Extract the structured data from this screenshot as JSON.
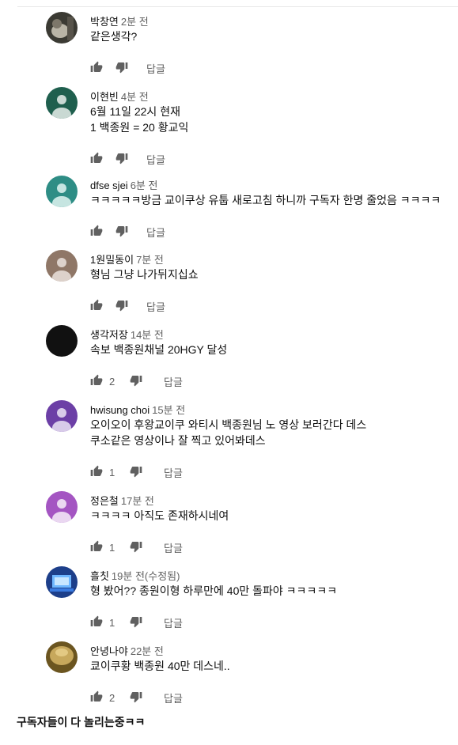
{
  "comments": [
    {
      "author": "박창연",
      "time": "2분 전",
      "lines": [
        "같은생각?"
      ],
      "likes": "",
      "reply_label": "답글",
      "avatar": {
        "kind": "photo-cat",
        "colors": [
          "#3b3a33",
          "#b9b4a6"
        ]
      }
    },
    {
      "author": "이현빈",
      "time": "4분 전",
      "lines": [
        "6월 11일 22시 현재",
        "1 백종원 = 20 황교익"
      ],
      "likes": "",
      "reply_label": "답글",
      "avatar": {
        "kind": "default",
        "colors": [
          "#1f5f4e",
          "#c9d9d3"
        ]
      }
    },
    {
      "author": "dfse sjei",
      "time": "6분 전",
      "lines": [
        "ㅋㅋㅋㅋㅋ방금 교이쿠상 유툽 새로고침 하니까 구독자 한명 줄었음 ㅋㅋㅋㅋ"
      ],
      "likes": "",
      "reply_label": "답글",
      "avatar": {
        "kind": "default",
        "colors": [
          "#2e8d85",
          "#c6e5e1"
        ]
      }
    },
    {
      "author": "1원밀동이",
      "time": "7분 전",
      "lines": [
        "형님 그냥 나가뒤지십쇼"
      ],
      "likes": "",
      "reply_label": "답글",
      "avatar": {
        "kind": "default",
        "colors": [
          "#8f7767",
          "#ddd2cb"
        ]
      }
    },
    {
      "author": "생각저장",
      "time": "14분 전",
      "lines": [
        "속보 백종원채널 20HGY 달성"
      ],
      "likes": "2",
      "reply_label": "답글",
      "avatar": {
        "kind": "solid",
        "colors": [
          "#111111",
          "#111111"
        ]
      }
    },
    {
      "author": "hwisung choi",
      "time": "15분 전",
      "lines": [
        "오이오이 후왕교이쿠 와티시 백종원님 노 영상 보러간다 데스",
        "쿠소같은 영상이나 잘 찍고 있어봐데스"
      ],
      "likes": "1",
      "reply_label": "답글",
      "avatar": {
        "kind": "default",
        "colors": [
          "#6c3fa6",
          "#d8cbe9"
        ]
      }
    },
    {
      "author": "정은철",
      "time": "17분 전",
      "lines": [
        "ㅋㅋㅋㅋ  아직도 존재하시네여"
      ],
      "likes": "1",
      "reply_label": "답글",
      "avatar": {
        "kind": "default",
        "colors": [
          "#a455c2",
          "#ead7f1"
        ]
      }
    },
    {
      "author": "흘칫",
      "time": "19분 전(수정됨)",
      "lines": [
        "형 봤어?? 종원이형 하루만에 40만 돌파야 ㅋㅋㅋㅋㅋ"
      ],
      "likes": "1",
      "reply_label": "답글",
      "avatar": {
        "kind": "photo-blue",
        "colors": [
          "#1d3f8a",
          "#6fb7ff"
        ]
      }
    },
    {
      "author": "안녕나야",
      "time": "22분 전",
      "lines": [
        "쿄이쿠황 백종원 40만 데스네.."
      ],
      "likes": "2",
      "reply_label": "답글",
      "avatar": {
        "kind": "photo-gold",
        "colors": [
          "#6b5520",
          "#c7a85c"
        ]
      }
    }
  ],
  "caption": "구독자들이 다 놀리는중ㅋㅋ",
  "icons": {
    "like": "thumbs-up-icon",
    "dislike": "thumbs-down-icon"
  },
  "colors": {
    "text": "#0f0f0f",
    "secondary": "#606060",
    "icon": "#606060"
  }
}
